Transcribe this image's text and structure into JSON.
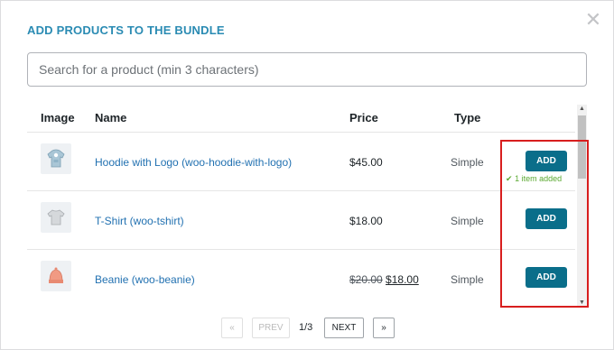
{
  "modal": {
    "title": "ADD PRODUCTS TO THE BUNDLE",
    "close_icon": "close-icon"
  },
  "search": {
    "placeholder": "Search for a product (min 3 characters)",
    "value": ""
  },
  "table": {
    "columns": [
      "Image",
      "Name",
      "Price",
      "Type"
    ],
    "rows": [
      {
        "image_icon": "hoodie-icon",
        "name": "Hoodie with Logo (woo-hoodie-with-logo)",
        "price": "$45.00",
        "type": "Simple",
        "action": "ADD",
        "status": "1 item added"
      },
      {
        "image_icon": "tshirt-icon",
        "name": "T-Shirt (woo-tshirt)",
        "price": "$18.00",
        "type": "Simple",
        "action": "ADD"
      },
      {
        "image_icon": "beanie-icon",
        "name": "Beanie (woo-beanie)",
        "price_old": "$20.00",
        "price": "$18.00",
        "type": "Simple",
        "action": "ADD"
      }
    ]
  },
  "pagination": {
    "first": "«",
    "prev": "PREV",
    "page": "1/3",
    "next": "NEXT",
    "last": "»"
  },
  "colors": {
    "title": "#2a8bb3",
    "link": "#2271b1",
    "button": "#0a6e8a",
    "added": "#5aa830",
    "highlight": "#d81e1e"
  }
}
